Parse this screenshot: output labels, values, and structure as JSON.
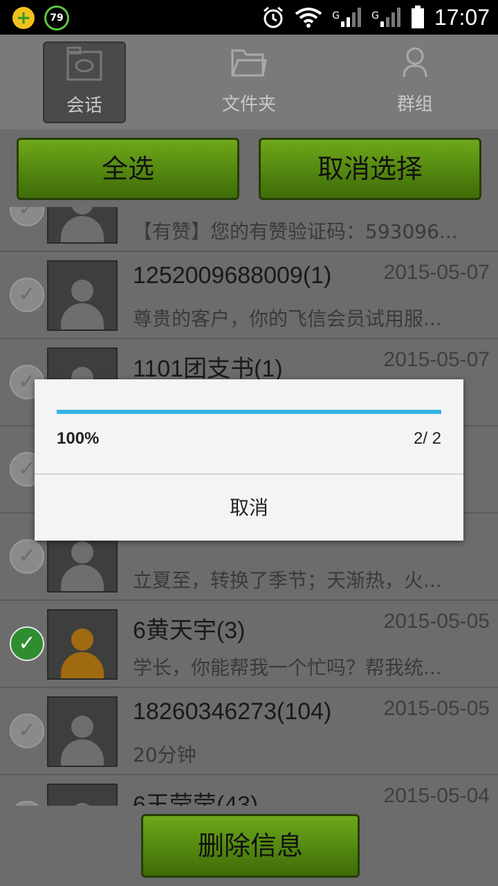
{
  "status_bar": {
    "badge_number": "79",
    "network_labels": [
      "G",
      "G"
    ],
    "time": "17:07",
    "icons": [
      "plus-icon",
      "alarm-icon",
      "wifi-icon",
      "signal-icon",
      "battery-icon"
    ]
  },
  "tabs": [
    {
      "label": "会话",
      "icon": "chat-icon",
      "active": true
    },
    {
      "label": "文件夹",
      "icon": "folder-icon",
      "active": false
    },
    {
      "label": "群组",
      "icon": "person-icon",
      "active": false
    }
  ],
  "actions": {
    "select_all": "全选",
    "deselect": "取消选择"
  },
  "conversations": [
    {
      "name": "",
      "date": "",
      "preview": "【有赞】您的有赞验证码：593096...",
      "checked": false,
      "avatar_color": "gray"
    },
    {
      "name": "1252009688009(1)",
      "date": "2015-05-07",
      "preview": "尊贵的客户，你的飞信会员试用服...",
      "checked": false,
      "avatar_color": "gray"
    },
    {
      "name": "1101团支书(1)",
      "date": "2015-05-07",
      "preview": "",
      "checked": false,
      "avatar_color": "gray"
    },
    {
      "name": "",
      "date": "",
      "preview": "",
      "checked": false,
      "avatar_color": "gray"
    },
    {
      "name": "",
      "date": "",
      "preview": "立夏至，转换了季节；天渐热，火...",
      "checked": false,
      "avatar_color": "gray"
    },
    {
      "name": "6黄天宇(3)",
      "date": "2015-05-05",
      "preview": "学长，你能帮我一个忙吗？帮我统...",
      "checked": true,
      "avatar_color": "orange"
    },
    {
      "name": "18260346273(104)",
      "date": "2015-05-05",
      "preview": "20分钟",
      "checked": false,
      "avatar_color": "gray"
    },
    {
      "name": "6王莹莹(43)",
      "date": "2015-05-04",
      "preview": "",
      "checked": false,
      "avatar_color": "gray"
    }
  ],
  "delete_button": "删除信息",
  "dialog": {
    "progress_fraction": 1.0,
    "percent_text": "100%",
    "count_text": "2/ 2",
    "cancel_label": "取消"
  }
}
